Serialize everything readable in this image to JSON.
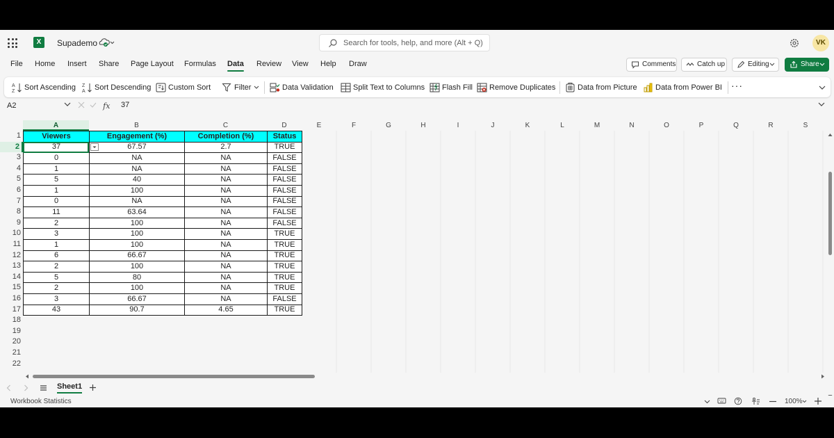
{
  "app": {
    "document_name": "Supademo",
    "search_placeholder": "Search for tools, help, and more (Alt + Q)",
    "user_initials": "VK"
  },
  "menu": {
    "tabs": [
      "File",
      "Home",
      "Insert",
      "Share",
      "Page Layout",
      "Formulas",
      "Data",
      "Review",
      "View",
      "Help",
      "Draw"
    ],
    "active_tab": "Data",
    "comments_label": "Comments",
    "catchup_label": "Catch up",
    "editing_label": "Editing",
    "share_label": "Share"
  },
  "ribbon": {
    "sort_asc": "Sort Ascending",
    "sort_desc": "Sort Descending",
    "custom_sort": "Custom Sort",
    "filter": "Filter",
    "data_validation": "Data Validation",
    "split_text": "Split Text to Columns",
    "flash_fill": "Flash Fill",
    "remove_dup": "Remove Duplicates",
    "data_from_picture": "Data from Picture",
    "data_from_powerbi": "Data from Power BI",
    "more": "···"
  },
  "formula_bar": {
    "name_box": "A2",
    "fx": "fx",
    "value": "37"
  },
  "grid": {
    "columns": [
      "A",
      "B",
      "C",
      "D",
      "E",
      "F",
      "G",
      "H",
      "I",
      "J",
      "K",
      "L",
      "M",
      "N",
      "O",
      "P",
      "Q",
      "R",
      "S"
    ],
    "rows": [
      "1",
      "2",
      "3",
      "4",
      "5",
      "6",
      "7",
      "8",
      "9",
      "10",
      "11",
      "12",
      "13",
      "14",
      "15",
      "16",
      "17",
      "18",
      "19",
      "20",
      "21",
      "22"
    ],
    "selected_column": "A",
    "selected_row": "2",
    "headers": [
      "Viewers",
      "Engagement (%)",
      "Completion (%)",
      "Status"
    ],
    "data": [
      [
        "37",
        "67.57",
        "2.7",
        "TRUE"
      ],
      [
        "0",
        "NA",
        "NA",
        "FALSE"
      ],
      [
        "1",
        "NA",
        "NA",
        "FALSE"
      ],
      [
        "5",
        "40",
        "NA",
        "FALSE"
      ],
      [
        "1",
        "100",
        "NA",
        "FALSE"
      ],
      [
        "0",
        "NA",
        "NA",
        "FALSE"
      ],
      [
        "11",
        "63.64",
        "NA",
        "FALSE"
      ],
      [
        "2",
        "100",
        "NA",
        "FALSE"
      ],
      [
        "3",
        "100",
        "NA",
        "TRUE"
      ],
      [
        "1",
        "100",
        "NA",
        "TRUE"
      ],
      [
        "6",
        "66.67",
        "NA",
        "TRUE"
      ],
      [
        "2",
        "100",
        "NA",
        "TRUE"
      ],
      [
        "5",
        "80",
        "NA",
        "TRUE"
      ],
      [
        "2",
        "100",
        "NA",
        "TRUE"
      ],
      [
        "3",
        "66.67",
        "NA",
        "FALSE"
      ],
      [
        "43",
        "90.7",
        "4.65",
        "TRUE"
      ]
    ]
  },
  "sheets": {
    "active": "Sheet1"
  },
  "status": {
    "workbook_stats": "Workbook Statistics",
    "zoom": "100%"
  },
  "colors": {
    "accent": "#107c41",
    "header_fill": "#00ffff"
  }
}
